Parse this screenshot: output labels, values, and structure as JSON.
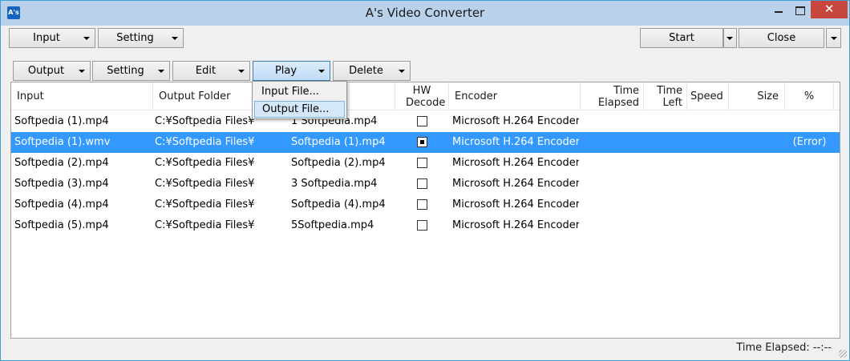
{
  "window": {
    "title": "A's Video Converter",
    "icon_text": "A's",
    "close_glyph": "✕"
  },
  "toolbar": {
    "input": "Input",
    "setting": "Setting",
    "start": "Start",
    "close": "Close"
  },
  "subtoolbar": {
    "output": "Output",
    "setting": "Setting",
    "edit": "Edit",
    "play": "Play",
    "delete": "Delete"
  },
  "play_menu": {
    "items": [
      "Input File...",
      "Output File..."
    ],
    "highlighted_index": 1
  },
  "columns": {
    "input": "Input",
    "output_folder": "Output Folder",
    "hw_decode": "HW Decode",
    "encoder": "Encoder",
    "time_elapsed": "Time Elapsed",
    "time_left": "Time Left",
    "speed": "Speed",
    "size": "Size",
    "percent": "%"
  },
  "rows": [
    {
      "input": "Softpedia (1).mp4",
      "output_folder": "C:¥Softpedia Files¥",
      "output_file": "1 Softpedia.mp4",
      "hw_decode": false,
      "encoder": "Microsoft H.264 Encoder",
      "percent": ""
    },
    {
      "input": "Softpedia (1).wmv",
      "output_folder": "C:¥Softpedia Files¥",
      "output_file": "Softpedia (1).mp4",
      "hw_decode": true,
      "encoder": "Microsoft H.264 Encoder",
      "percent": "(Error)"
    },
    {
      "input": "Softpedia (2).mp4",
      "output_folder": "C:¥Softpedia Files¥",
      "output_file": "Softpedia (2).mp4",
      "hw_decode": false,
      "encoder": "Microsoft H.264 Encoder",
      "percent": ""
    },
    {
      "input": "Softpedia (3).mp4",
      "output_folder": "C:¥Softpedia Files¥",
      "output_file": "3 Softpedia.mp4",
      "hw_decode": false,
      "encoder": "Microsoft H.264 Encoder",
      "percent": ""
    },
    {
      "input": "Softpedia (4).mp4",
      "output_folder": "C:¥Softpedia Files¥",
      "output_file": "Softpedia (4).mp4",
      "hw_decode": false,
      "encoder": "Microsoft H.264 Encoder",
      "percent": ""
    },
    {
      "input": "Softpedia (5).mp4",
      "output_folder": "C:¥Softpedia Files¥",
      "output_file": "5Softpedia.mp4",
      "hw_decode": false,
      "encoder": "Microsoft H.264 Encoder",
      "percent": ""
    }
  ],
  "selected_row": 1,
  "status": {
    "text": "Time Elapsed: --:--"
  }
}
